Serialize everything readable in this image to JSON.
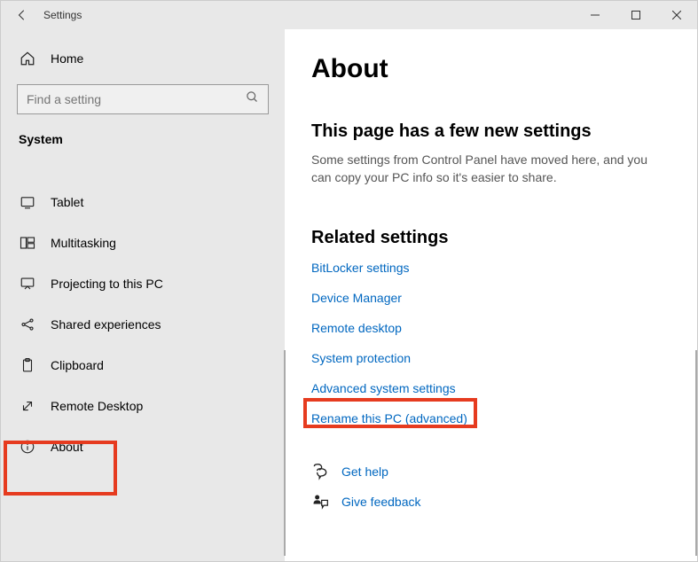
{
  "titlebar": {
    "title": "Settings"
  },
  "sidebar": {
    "home": "Home",
    "search_placeholder": "Find a setting",
    "group": "System",
    "items": [
      {
        "label": "Tablet",
        "icon": "tablet"
      },
      {
        "label": "Multitasking",
        "icon": "multitasking"
      },
      {
        "label": "Projecting to this PC",
        "icon": "projecting"
      },
      {
        "label": "Shared experiences",
        "icon": "shared"
      },
      {
        "label": "Clipboard",
        "icon": "clipboard"
      },
      {
        "label": "Remote Desktop",
        "icon": "remote"
      },
      {
        "label": "About",
        "icon": "about"
      }
    ]
  },
  "content": {
    "title": "About",
    "subheading": "This page has a few new settings",
    "description": "Some settings from Control Panel have moved here, and you can copy your PC info so it's easier to share.",
    "related_heading": "Related settings",
    "links": [
      "BitLocker settings",
      "Device Manager",
      "Remote desktop",
      "System protection",
      "Advanced system settings",
      "Rename this PC (advanced)"
    ],
    "help": {
      "get_help": "Get help",
      "feedback": "Give feedback"
    }
  }
}
